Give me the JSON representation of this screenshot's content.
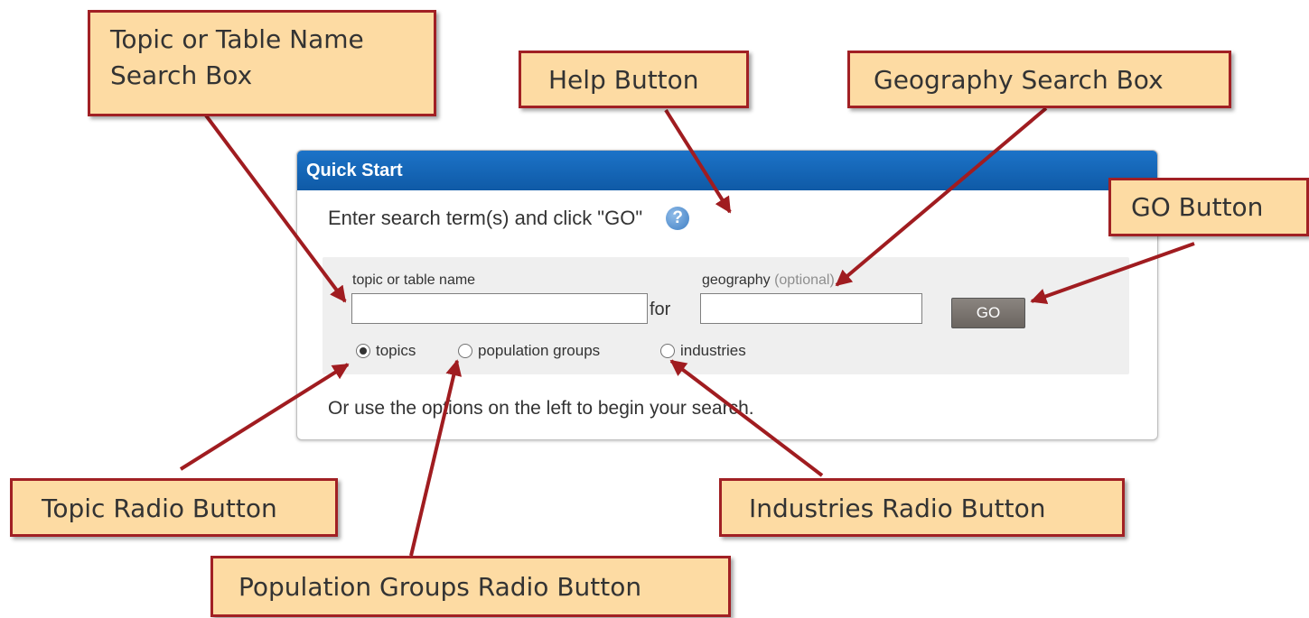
{
  "panel": {
    "title": "Quick Start",
    "instructions": "Enter search term(s) and click \"GO\"",
    "help_icon": "?",
    "topic_label": "topic or table name",
    "topic_value": "",
    "for_label": "for",
    "geography_label": "geography",
    "geography_optional": "(optional)",
    "geography_value": "",
    "go_label": "GO",
    "radio_options": [
      {
        "label": "topics",
        "checked": true
      },
      {
        "label": "population groups",
        "checked": false
      },
      {
        "label": "industries",
        "checked": false
      }
    ],
    "footer": "Or use the options on the left to begin your search."
  },
  "callouts": {
    "topic_search": "Topic or Table Name\nSearch Box",
    "help_button": "Help Button",
    "geography_search": "Geography Search Box",
    "go_button": "GO Button",
    "topic_radio": "Topic Radio Button",
    "industries_radio": "Industries Radio Button",
    "population_radio": "Population Groups Radio Button"
  },
  "colors": {
    "header_blue": "#1565b8",
    "callout_fill": "#fddba3",
    "callout_border": "#a12024",
    "arrow": "#a01c20",
    "go_button": "#736d68"
  }
}
